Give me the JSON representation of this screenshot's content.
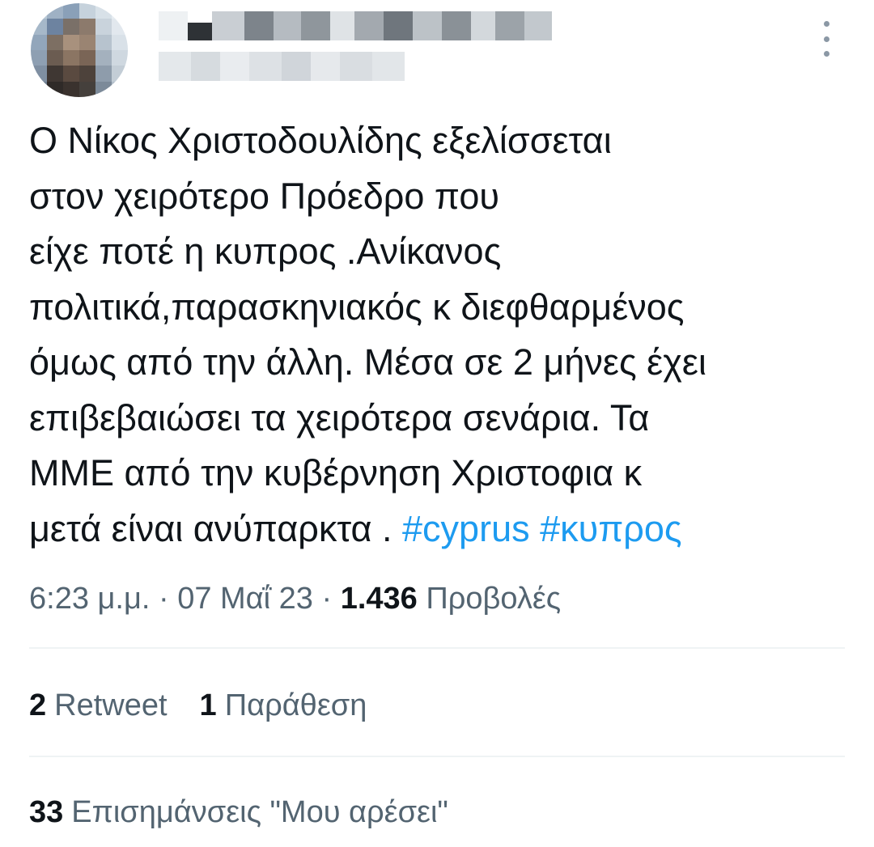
{
  "header": {
    "avatar_alt": "",
    "name": "",
    "handle": "",
    "more_icon": "more-vertical-icon"
  },
  "tweet": {
    "lines": [
      "Ο Νίκος Χριστοδουλίδης εξελίσσεται",
      "στον χειρότερο Πρόεδρο που",
      "είχε ποτέ η κυπρος .Ανίκανος",
      "πολιτικά,παρασκηνιακός κ διεφθαρμένος",
      "όμως από την άλλη. Μέσα σε 2 μήνες έχει",
      "επιβεβαιώσει τα χειρότερα σενάρια. Τα",
      "ΜΜΕ από την κυβέρνηση Χριστοφια κ"
    ],
    "last_line_text": "μετά είναι ανύπαρκτα . ",
    "hashtags": [
      "#cyprus",
      "#κυπρος"
    ]
  },
  "meta": {
    "time": "6:23 μ.μ.",
    "sep1": " · ",
    "date": "07 Μαΐ 23",
    "sep2": " · ",
    "views_count": "1.436",
    "views_label": " Προβολές"
  },
  "stats": {
    "retweets_count": "2",
    "retweets_label": "Retweet",
    "quotes_count": "1",
    "quotes_label": "Παράθεση",
    "likes_count": "33",
    "likes_label": "Επισημάνσεις \"Μου αρέσει\""
  },
  "colors": {
    "text": "#0f1419",
    "secondary": "#536471",
    "link": "#1d9bf0",
    "divider": "#eff3f4"
  }
}
